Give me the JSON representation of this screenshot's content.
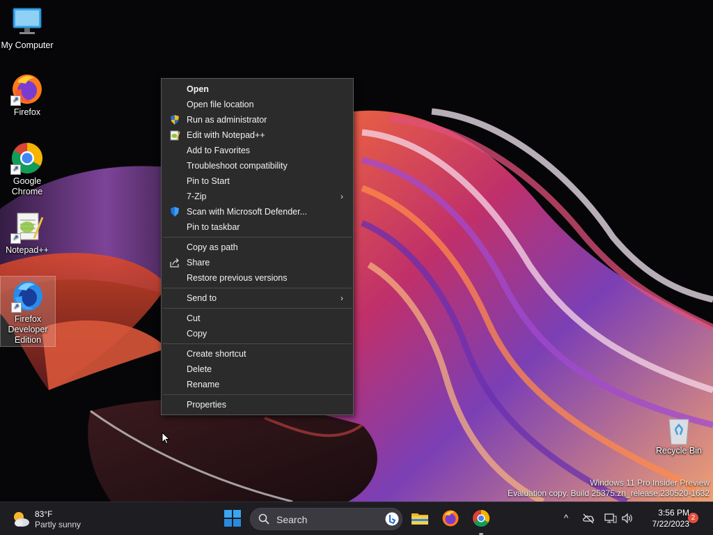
{
  "desktop": {
    "icons": [
      {
        "label": "My Computer"
      },
      {
        "label": "Firefox"
      },
      {
        "label": "Google Chrome"
      },
      {
        "label": "Notepad++"
      },
      {
        "label": "Firefox Developer Edition"
      },
      {
        "label": "Recycle Bin"
      }
    ]
  },
  "context_menu": {
    "items": [
      {
        "label": "Open"
      },
      {
        "label": "Open file location"
      },
      {
        "label": "Run as administrator",
        "icon": "uac-shield-icon"
      },
      {
        "label": "Edit with Notepad++",
        "icon": "notepadpp-icon"
      },
      {
        "label": "Add to Favorites"
      },
      {
        "label": "Troubleshoot compatibility"
      },
      {
        "label": "Pin to Start"
      },
      {
        "label": "7-Zip"
      },
      {
        "label": "Scan with Microsoft Defender...",
        "icon": "defender-shield-icon"
      },
      {
        "label": "Pin to taskbar"
      },
      {
        "label": "Copy as path"
      },
      {
        "label": "Share",
        "icon": "share-icon"
      },
      {
        "label": "Restore previous versions"
      },
      {
        "label": "Send to"
      },
      {
        "label": "Cut"
      },
      {
        "label": "Copy"
      },
      {
        "label": "Create shortcut"
      },
      {
        "label": "Delete"
      },
      {
        "label": "Rename"
      },
      {
        "label": "Properties"
      }
    ],
    "submenu_arrow": "›"
  },
  "watermark": {
    "line1": "Windows 11 Pro Insider Preview",
    "line2": "Evaluation copy. Build 25375.zn_release.230520-1632"
  },
  "taskbar": {
    "weather": {
      "temp": "83°F",
      "condition": "Partly sunny"
    },
    "search": {
      "label": "Search"
    },
    "clock": {
      "time": "3:56 PM",
      "date": "7/22/2023"
    },
    "notification_count": "2",
    "tray_overflow": "^"
  },
  "colors": {
    "menu_bg": "#2b2b2b",
    "taskbar_bg": "#1d1d22",
    "accent": "#0078d4",
    "notification": "#e44e3e"
  }
}
